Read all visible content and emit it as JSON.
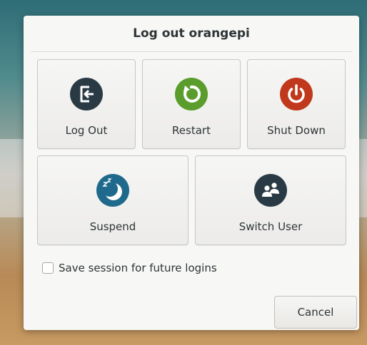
{
  "dialog": {
    "title": "Log out orangepi",
    "actions": [
      {
        "id": "logout",
        "label": "Log Out",
        "icon": "logout-icon",
        "color": "#2a3a44"
      },
      {
        "id": "restart",
        "label": "Restart",
        "icon": "restart-icon",
        "color": "#5a9d2c"
      },
      {
        "id": "shutdown",
        "label": "Shut Down",
        "icon": "power-icon",
        "color": "#c0391c"
      },
      {
        "id": "suspend",
        "label": "Suspend",
        "icon": "suspend-moon-icon",
        "color": "#1f6a8c"
      },
      {
        "id": "switch_user",
        "label": "Switch User",
        "icon": "switch-user-icon",
        "color": "#2a3a44"
      }
    ],
    "save_session": {
      "label": "Save session for future logins",
      "checked": false
    },
    "cancel_label": "Cancel"
  }
}
